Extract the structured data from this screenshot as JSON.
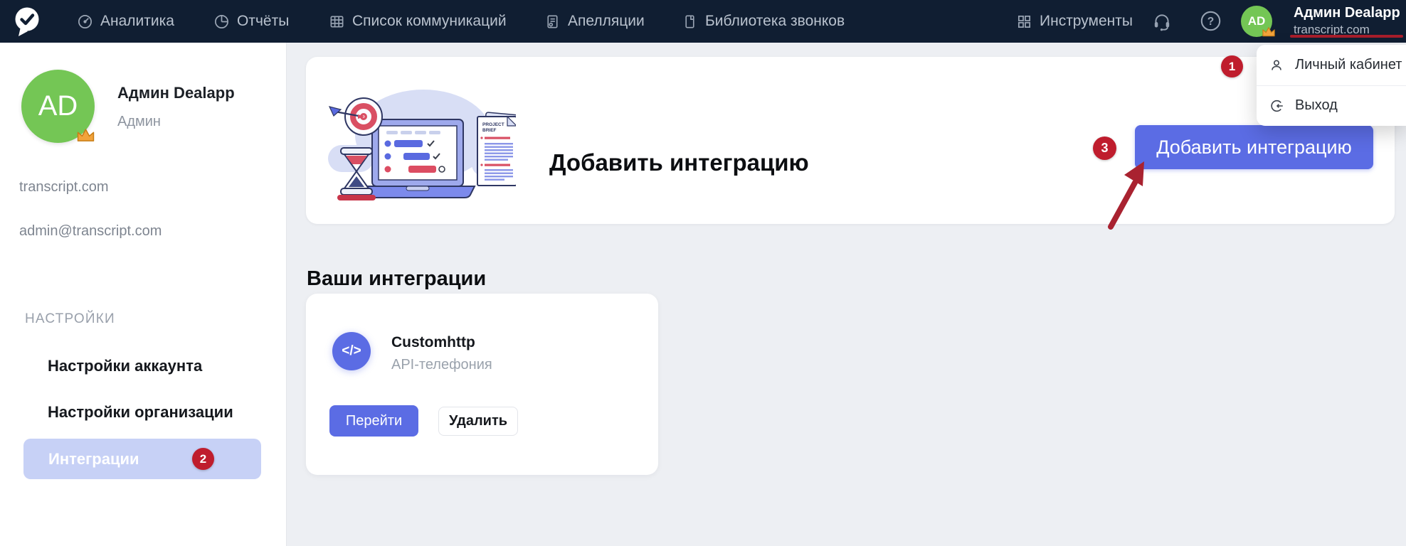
{
  "navbar": {
    "items": [
      {
        "label": "Аналитика"
      },
      {
        "label": "Отчёты"
      },
      {
        "label": "Список коммуникаций"
      },
      {
        "label": "Апелляции"
      },
      {
        "label": "Библиотека звонков"
      }
    ],
    "tools": {
      "label": "Инструменты"
    },
    "user": {
      "initials": "AD",
      "name": "Админ Dealapp",
      "org": "transcript.com"
    }
  },
  "user_menu": {
    "account_label": "Личный кабинет",
    "logout_label": "Выход"
  },
  "sidebar": {
    "profile": {
      "initials": "AD",
      "name": "Админ Dealapp",
      "role": "Админ",
      "org": "transcript.com",
      "email": "admin@transcript.com"
    },
    "section_title": "НАСТРОЙКИ",
    "items": [
      {
        "label": "Настройки аккаунта"
      },
      {
        "label": "Настройки организации"
      },
      {
        "label": "Интеграции",
        "badge": "2"
      }
    ]
  },
  "main": {
    "header_card": {
      "title": "Добавить интеграцию",
      "button_label": "Добавить интеграцию"
    },
    "illustration": {
      "doc_text_1": "PROJECT",
      "doc_text_2": "BRIEF"
    },
    "integrations_heading": "Ваши интеграции",
    "integration_card": {
      "icon_glyph": "</>",
      "name": "Customhttp",
      "type": "API-телефония",
      "open_label": "Перейти",
      "delete_label": "Удалить"
    }
  },
  "annotations": {
    "step1": "1",
    "step2": "2",
    "step3": "3"
  },
  "colors": {
    "navbar_bg": "#101e32",
    "accent": "#5b6ce4",
    "badge_red": "#bf1d2d",
    "avatar_green": "#74c655",
    "selected_item_bg": "#c7d1f6",
    "main_bg": "#edeff3"
  }
}
